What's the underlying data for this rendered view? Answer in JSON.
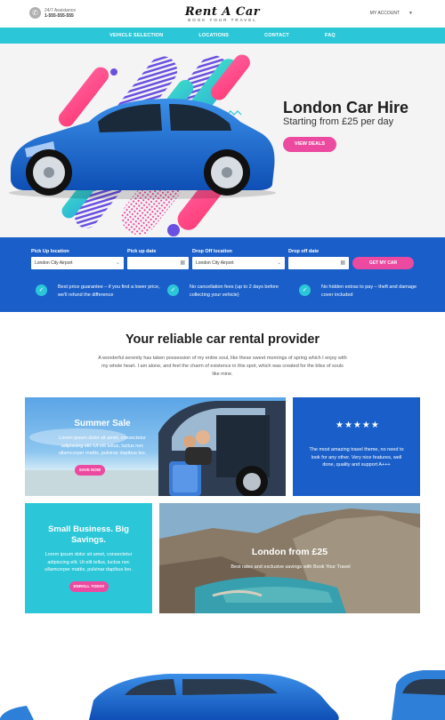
{
  "header": {
    "assistance_label": "24/7 Assistance",
    "phone": "1-555-555-555",
    "logo": "Rent A Car",
    "tagline": "BOOK YOUR TRAVEL",
    "account": "MY ACCOUNT"
  },
  "nav": {
    "items": [
      "VEHICLE SELECTION",
      "LOCATIONS",
      "CONTACT",
      "FAQ"
    ]
  },
  "hero": {
    "title": "London Car Hire",
    "subtitle": "Starting from £25 per day",
    "cta": "VIEW DEALS"
  },
  "search": {
    "pickup_location_label": "Pick Up location",
    "pickup_location_value": "London City Airport",
    "pickup_date_label": "Pick up date",
    "dropoff_location_label": "Drop Off location",
    "dropoff_location_value": "London City Airport",
    "dropoff_date_label": "Drop off date",
    "submit": "GET MY CAR",
    "features": [
      "Best price guarantee – if you find a lower price, we'll refund the difference",
      "No cancellation fees (up to 2 days before collecting your vehicle)",
      "No hidden extras to pay – theft and damage cover included"
    ]
  },
  "intro": {
    "title": "Your reliable car rental provider",
    "text": "A wonderful serenity has taken possession of my entire soul, like these sweet mornings of spring which I enjoy with my whole heart. I am alone, and feel the charm of existence in this spot, which was created for the bliss of souls like mine."
  },
  "cards": {
    "summer": {
      "title": "Summer Sale",
      "text": "Lorem ipsum dolor sit amet, consectetur adipiscing elit. Ut elit tellus, luctus nec ullamcorper mattis, pulvinar dapibus leo.",
      "cta": "SAVE NOW"
    },
    "review": {
      "stars": "★★★★★",
      "text": "The most amazing travel theme, no need to look for any other. Very nice features, well done, quality and support A+++"
    },
    "business": {
      "title": "Small Business. Big Savings.",
      "text": "Lorem ipsum dolor sit amet, consectetur adipiscing elit. Ut elit tellus, luctus nec ullamcorper mattis, pulvinar dapibus leo.",
      "cta": "ENROLL TODAY"
    },
    "london": {
      "title": "London from £25",
      "text": "Best rates and exclusive savings with Book Your Travel"
    }
  },
  "colors": {
    "accent": "#2bc7d8",
    "brand_blue": "#1a5fc9",
    "pink": "#ec4aa0"
  }
}
